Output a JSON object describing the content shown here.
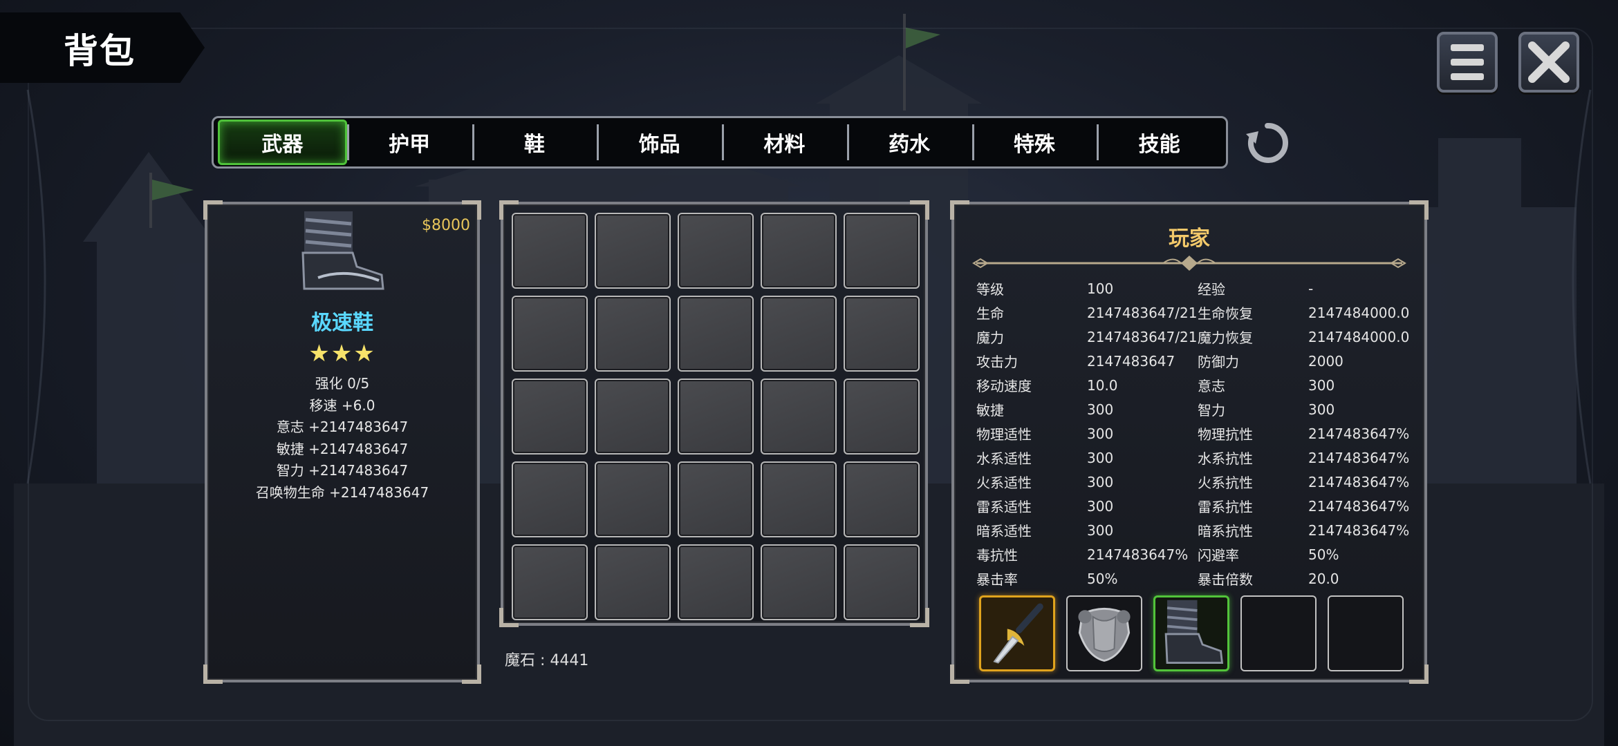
{
  "header": {
    "title": "背包"
  },
  "tabs": [
    {
      "label": "武器",
      "active": true
    },
    {
      "label": "护甲",
      "active": false
    },
    {
      "label": "鞋",
      "active": false
    },
    {
      "label": "饰品",
      "active": false
    },
    {
      "label": "材料",
      "active": false
    },
    {
      "label": "药水",
      "active": false
    },
    {
      "label": "特殊",
      "active": false
    },
    {
      "label": "技能",
      "active": false
    }
  ],
  "item": {
    "price": "$8000",
    "name": "极速鞋",
    "stars": "★★★",
    "star_count": 3,
    "stats": [
      "强化 0/5",
      "移速  +6.0",
      "意志  +2147483647",
      "敏捷  +2147483647",
      "智力  +2147483647",
      "召唤物生命  +2147483647"
    ]
  },
  "inventory": {
    "rows": 5,
    "cols": 5,
    "magic_stone": "魔石 : 4441"
  },
  "player": {
    "title": "玩家",
    "stats": [
      [
        "等级",
        "100",
        "经验",
        "-"
      ],
      [
        "生命",
        "2147483647/21",
        "生命恢复",
        "2147484000.0"
      ],
      [
        "魔力",
        "2147483647/21",
        "魔力恢复",
        "2147484000.0"
      ],
      [
        "攻击力",
        "2147483647",
        "防御力",
        "2000"
      ],
      [
        "移动速度",
        "10.0",
        "意志",
        "300"
      ],
      [
        "敏捷",
        "300",
        "智力",
        "300"
      ],
      [
        "物理适性",
        "300",
        "物理抗性",
        "2147483647%"
      ],
      [
        "水系适性",
        "300",
        "水系抗性",
        "2147483647%"
      ],
      [
        "火系适性",
        "300",
        "火系抗性",
        "2147483647%"
      ],
      [
        "雷系适性",
        "300",
        "雷系抗性",
        "2147483647%"
      ],
      [
        "暗系适性",
        "300",
        "暗系抗性",
        "2147483647%"
      ],
      [
        "毒抗性",
        "2147483647%",
        "闪避率",
        "50%"
      ],
      [
        "暴击率",
        "50%",
        "暴击倍数",
        "20.0"
      ]
    ],
    "equipment": [
      {
        "icon": "sword-icon",
        "rarity": "gold"
      },
      {
        "icon": "armor-icon",
        "rarity": "normal"
      },
      {
        "icon": "boot-icon",
        "rarity": "green"
      },
      {
        "icon": "empty",
        "rarity": "empty"
      },
      {
        "icon": "empty",
        "rarity": "empty"
      }
    ]
  },
  "colors": {
    "item_name": "#5ad8ff",
    "price": "#e7c55a",
    "stars": "#f7e36a",
    "player_title": "#f3c96a",
    "active_tab": "#4fc23a"
  }
}
